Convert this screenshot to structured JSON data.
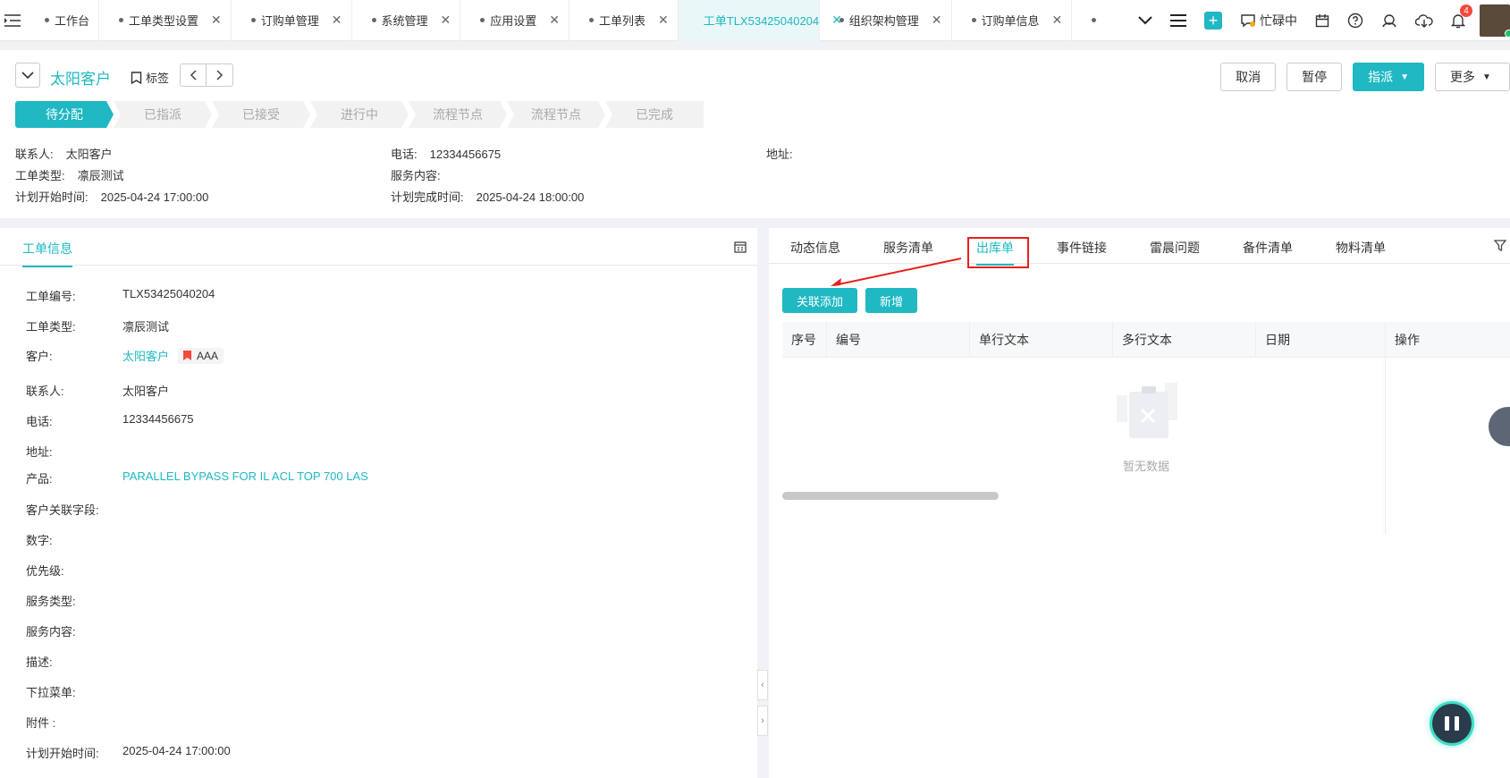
{
  "topbar": {
    "tabs": [
      {
        "label": "工作台",
        "active": false
      },
      {
        "label": "工单类型设置",
        "active": false
      },
      {
        "label": "订购单管理",
        "active": false
      },
      {
        "label": "系统管理",
        "active": false
      },
      {
        "label": "应用设置",
        "active": false
      },
      {
        "label": "工单列表",
        "active": false
      },
      {
        "label": "工单TLX53425040204",
        "active": true
      },
      {
        "label": "组织架构管理",
        "active": false
      },
      {
        "label": "订购单信息",
        "active": false
      }
    ],
    "status_label": "忙碌中",
    "notification_count": "4"
  },
  "header": {
    "customer_name": "太阳客户",
    "tag_label": "标签",
    "actions": {
      "cancel": "取消",
      "pause": "暂停",
      "assign": "指派",
      "more": "更多"
    },
    "steps": [
      "待分配",
      "已指派",
      "已接受",
      "进行中",
      "流程节点",
      "流程节点",
      "已完成"
    ],
    "current_step_index": 0,
    "info": {
      "contact_label": "联系人:",
      "contact_value": "太阳客户",
      "phone_label": "电话:",
      "phone_value": "12334456675",
      "address_label": "地址:",
      "type_label": "工单类型:",
      "type_value": "凛辰测试",
      "service_label": "服务内容:",
      "plan_start_label": "计划开始时间:",
      "plan_start_value": "2025-04-24 17:00:00",
      "plan_end_label": "计划完成时间:",
      "plan_end_value": "2025-04-24 18:00:00"
    }
  },
  "left_panel": {
    "tab_label": "工单信息",
    "fields": {
      "order_no_label": "工单编号:",
      "order_no_value": "TLX53425040204",
      "type_label": "工单类型:",
      "type_value": "凛辰测试",
      "customer_label": "客户:",
      "customer_value": "太阳客户",
      "customer_tag": "AAA",
      "contact_label": "联系人:",
      "contact_value": "太阳客户",
      "phone_label": "电话:",
      "phone_value": "12334456675",
      "address_label": "地址:",
      "product_label": "产品:",
      "product_value": "PARALLEL BYPASS FOR IL ACL TOP 700 LAS",
      "cust_field_label": "客户关联字段:",
      "number_label": "数字:",
      "priority_label": "优先级:",
      "service_type_label": "服务类型:",
      "service_content_label": "服务内容:",
      "desc_label": "描述:",
      "dropdown_label": "下拉菜单:",
      "attachment_label": "附件 :",
      "plan_start_label": "计划开始时间:",
      "plan_start_value": "2025-04-24 17:00:00"
    }
  },
  "right_panel": {
    "tabs": [
      "动态信息",
      "服务清单",
      "出库单",
      "事件链接",
      "雷晨问题",
      "备件清单",
      "物料清单"
    ],
    "active_tab_index": 2,
    "buttons": {
      "link_add": "关联添加",
      "add_new": "新增"
    },
    "table": {
      "columns": [
        "序号",
        "编号",
        "单行文本",
        "多行文本",
        "日期",
        "操作"
      ],
      "rows": [],
      "empty_text": "暂无数据"
    }
  },
  "colors": {
    "accent": "#1fb8c3",
    "highlight": "#e5221c",
    "badge": "#f5483b"
  }
}
